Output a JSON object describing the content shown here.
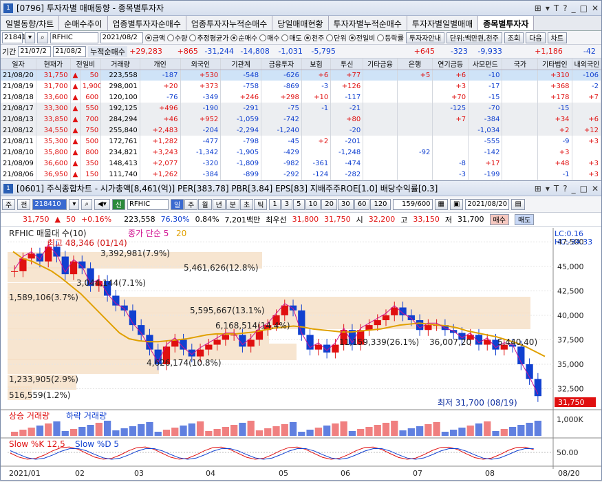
{
  "win1": {
    "num": "1",
    "title": "[0796] 투자자별 매매동향 - 종목별투자자",
    "controls": [
      "⊞",
      "▾",
      "T",
      "?",
      "_",
      "□",
      "✕"
    ]
  },
  "tabs": [
    "일별동향/차트",
    "순매수추이",
    "업종별투자자순매수",
    "업종투자자누적순매수",
    "당일매매현황",
    "투자자별누적순매수",
    "투자자별일별매매",
    "종목별투자자"
  ],
  "filter": {
    "code": "218410",
    "name": "RFHIC",
    "date": "2021/08/2",
    "radios": [
      "금액",
      "수량",
      "추정평균가",
      "순매수",
      "매수",
      "매도",
      "천주",
      "단위"
    ],
    "radios2": [
      "전일비",
      "등락률"
    ],
    "extra": [
      "투자자안내",
      "단위:백만원,천주",
      "조회",
      "다음",
      "차트"
    ]
  },
  "period": {
    "label": "기간",
    "from": "21/07/2",
    "to": "21/08/2",
    "accum_label": "누적순매수",
    "sums": [
      "+29,283",
      "+865",
      "-31,244",
      "-14,808",
      "-1,031",
      "-5,795",
      "",
      "",
      "+645",
      "-323",
      "-9,933",
      "",
      "+1,186",
      "-42"
    ]
  },
  "table": {
    "headers": [
      "일자",
      "현재가",
      "전일비",
      "거래량",
      "개인",
      "외국인",
      "기관계",
      "금융투자",
      "보험",
      "투신",
      "기타금융",
      "은행",
      "연기금등",
      "사모펀드",
      "국가",
      "기타법인",
      "내외국인"
    ],
    "rows": [
      [
        "21/08/20",
        "31,750",
        "▲",
        "50",
        "223,558",
        "-187",
        "+530",
        "-548",
        "-626",
        "+6",
        "+77",
        "",
        "+5",
        "+6",
        "-10",
        "",
        "+310",
        "-106"
      ],
      [
        "21/08/19",
        "31,700",
        "▲",
        "1,900",
        "298,001",
        "+20",
        "+373",
        "-758",
        "-869",
        "-3",
        "+126",
        "",
        "",
        "+3",
        "-17",
        "",
        "+368",
        "-2"
      ],
      [
        "21/08/18",
        "33,600",
        "▲",
        "600",
        "120,100",
        "-76",
        "-349",
        "+246",
        "+298",
        "+10",
        "-117",
        "",
        "",
        "+70",
        "-15",
        "",
        "+178",
        "+7"
      ],
      [
        "21/08/17",
        "33,300",
        "▲",
        "550",
        "192,125",
        "+496",
        "-190",
        "-291",
        "-75",
        "-1",
        "-21",
        "",
        "",
        "-125",
        "-70",
        "",
        "-15",
        ""
      ],
      [
        "21/08/13",
        "33,850",
        "▲",
        "700",
        "284,294",
        "+46",
        "+952",
        "-1,059",
        "-742",
        "",
        "+80",
        "",
        "",
        "+7",
        "-384",
        "",
        "+34",
        "+6"
      ],
      [
        "21/08/12",
        "34,550",
        "▲",
        "750",
        "255,840",
        "+2,483",
        "-204",
        "-2,294",
        "-1,240",
        "",
        "-20",
        "",
        "",
        "",
        "-1,034",
        "",
        "+2",
        "+12"
      ],
      [
        "21/08/11",
        "35,300",
        "▲",
        "500",
        "172,761",
        "+1,282",
        "-477",
        "-798",
        "-45",
        "+2",
        "-201",
        "",
        "",
        "",
        "-555",
        "",
        "-9",
        "+3"
      ],
      [
        "21/08/10",
        "35,800",
        "▲",
        "800",
        "234,821",
        "+3,243",
        "-1,342",
        "-1,905",
        "-429",
        "",
        "-1,248",
        "",
        "-92",
        "",
        "-142",
        "",
        "+3",
        ""
      ],
      [
        "21/08/09",
        "36,600",
        "▲",
        "350",
        "148,413",
        "+2,077",
        "-320",
        "-1,809",
        "-982",
        "-361",
        "-474",
        "",
        "",
        "-8",
        "+17",
        "",
        "+48",
        "+3"
      ],
      [
        "21/08/06",
        "36,950",
        "▲",
        "150",
        "111,740",
        "+1,262",
        "-384",
        "-899",
        "-292",
        "-124",
        "-282",
        "",
        "",
        "-3",
        "-199",
        "",
        "-1",
        "+3"
      ]
    ]
  },
  "win2": {
    "num": "1",
    "title": "[0601] 주식종합차트 - 시가총액[8,461(억)] PER[383.78] PBR[3.84] EPS[83] 지배주주ROE[1.0] 배당수익률[0.3]",
    "controls": [
      "⊞",
      "▾",
      "T",
      "?",
      "_",
      "□",
      "✕"
    ]
  },
  "ctoolbar": {
    "type": "주",
    "prev": "전",
    "code": "218410",
    "market": "신",
    "name": "RFHIC",
    "periods": [
      "일",
      "주",
      "월",
      "년",
      "분",
      "초",
      "틱"
    ],
    "nums": [
      "1",
      "3",
      "5",
      "10",
      "20",
      "30",
      "60",
      "120"
    ],
    "count": "159/600",
    "date": "2021/08/20"
  },
  "quote": {
    "price": "31,750",
    "sign": "▲",
    "change": "50",
    "pct": "+0.16%",
    "volume": "223,558",
    "ratio": "76.30%",
    "turnover": "0.84%",
    "amount": "7,201백만",
    "best_label": "최우선",
    "ask": "31,800",
    "bid": "31,750",
    "open_label": "시",
    "open": "32,200",
    "high_label": "고",
    "high": "33,150",
    "low_label": "저",
    "low": "31,700",
    "buy": "매수",
    "sell": "매도"
  },
  "chart_data": {
    "type": "line",
    "title": "RFHIC",
    "legend": [
      "RFHIC 매물대 수(10)",
      "종가 단순 5",
      "20"
    ],
    "x": [
      "2021/01",
      "02",
      "03",
      "04",
      "05",
      "06",
      "07",
      "08",
      "08/20"
    ],
    "yticks": [
      47500,
      45000,
      42500,
      40000,
      37500,
      35000,
      32500
    ],
    "ylim": [
      30500,
      48500
    ],
    "close": [
      44500,
      45800,
      46300,
      45500,
      47000,
      46000,
      44200,
      45500,
      44800,
      43000,
      43500,
      42000,
      41000,
      40500,
      39000,
      38000,
      36500,
      35000,
      36800,
      37500,
      36500,
      35800,
      36500,
      37000,
      37500,
      38000,
      38000,
      36800,
      37500,
      38500,
      39000,
      40000,
      41000,
      40500,
      38000,
      36500,
      37000,
      36200,
      37000,
      38500,
      37000,
      38500,
      39000,
      39500,
      40000,
      40800,
      40000,
      39500,
      38500,
      39000,
      39000,
      38500,
      38200,
      37500,
      38000,
      37000,
      37500,
      36500,
      37000,
      36800,
      35000,
      33500,
      31750
    ],
    "ma20": [
      46500,
      45800,
      45500,
      45000,
      44500,
      43800,
      43000,
      42200,
      41200,
      40200,
      39200,
      38200,
      37600,
      37400,
      37300,
      37300,
      37400,
      37500,
      37600,
      37800,
      38000,
      38100,
      38100,
      38100,
      38200,
      38300,
      38500,
      38700,
      38800,
      38900,
      38800,
      38600,
      38500,
      38400,
      38300,
      38300,
      38400,
      38500,
      38600,
      38800,
      39000,
      39100,
      39200,
      39100,
      39000,
      38900,
      38700,
      38400,
      38200,
      38000,
      37800,
      37500,
      37200,
      36800,
      36300,
      35800
    ],
    "vol_profile": [
      "516,559(1.2%)",
      "1,233,905(2.9%)",
      "4,626,174(10.8%)",
      "6,168,514(14.4%)",
      "5,595,667(13.1%)",
      "11,159,339(26.1%)",
      "36,007,20",
      "5,440,40)",
      "1,589,106(3.7%)",
      "3,044,144(7.1%)",
      "5,461,626(12.8%)",
      "3,392,981(7.9%)"
    ],
    "max_label": "최고 48,346 (01/14)",
    "min_label": "최저 31,700 (08/19)",
    "lc": "LC:0.16",
    "hc": "HC:-34.33",
    "last": "31,750",
    "vol_legend": [
      "상승 거래량",
      "하락 거래량"
    ],
    "vol_tick": "1,000K",
    "stoch_legend": [
      "Slow %K 12,5",
      "Slow %D 5"
    ],
    "stoch_tick": "50.00",
    "colors": {
      "up": "#e01010",
      "down": "#1040d0",
      "ma20": "#e0a000",
      "ma5": "#d01090"
    }
  }
}
